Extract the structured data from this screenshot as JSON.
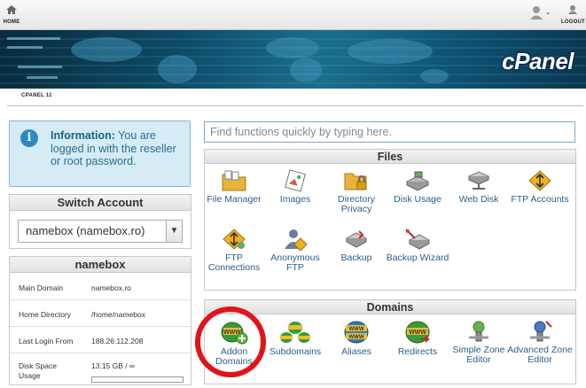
{
  "topbar": {
    "home_label": "HOME",
    "logout_label": "LOGOUT"
  },
  "banner": {
    "logo": "cPanel",
    "breadcrumb": "CPANEL 11"
  },
  "info": {
    "title": "Information:",
    "text": "You are logged in with the reseller or root password."
  },
  "switch_account": {
    "title": "Switch Account",
    "selected": "namebox (namebox.ro)"
  },
  "stats": {
    "title": "namebox",
    "rows": [
      {
        "key": "Main Domain",
        "value": "namebox.ro"
      },
      {
        "key": "Home Directory",
        "value": "/home/namebox"
      },
      {
        "key": "Last Login From",
        "value": "188.26.112.208"
      },
      {
        "key": "Disk Space Usage",
        "value": "13.15 GB / ∞"
      }
    ]
  },
  "search": {
    "placeholder": "Find functions quickly by typing here."
  },
  "files": {
    "title": "Files",
    "items": [
      {
        "label": "File Manager"
      },
      {
        "label": "Images"
      },
      {
        "label": "Directory Privacy"
      },
      {
        "label": "Disk Usage"
      },
      {
        "label": "Web Disk"
      },
      {
        "label": "FTP Accounts"
      },
      {
        "label": "FTP Connections"
      },
      {
        "label": "Anonymous FTP"
      },
      {
        "label": "Backup"
      },
      {
        "label": "Backup Wizard"
      }
    ]
  },
  "domains": {
    "title": "Domains",
    "items": [
      {
        "label": "Addon Domains"
      },
      {
        "label": "Subdomains"
      },
      {
        "label": "Aliases"
      },
      {
        "label": "Redirects"
      },
      {
        "label": "Simple Zone Editor"
      },
      {
        "label": "Advanced Zone Editor"
      }
    ]
  },
  "colors": {
    "accent": "#2a5d8a",
    "highlight": "#e0141a",
    "info_bg": "#d5ecf7"
  }
}
